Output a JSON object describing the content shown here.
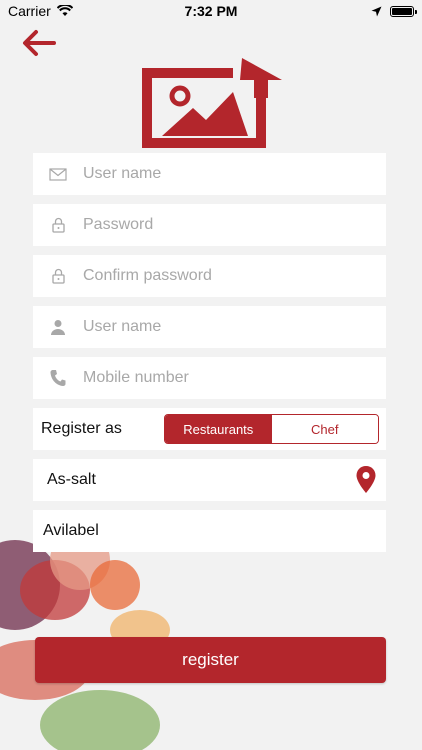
{
  "status_bar": {
    "carrier": "Carrier",
    "time": "7:32 PM"
  },
  "colors": {
    "accent": "#b3262c",
    "background": "#f2f2f2",
    "placeholder": "#a8a8a8"
  },
  "form": {
    "username_placeholder": "User name",
    "password_placeholder": "Password",
    "confirm_password_placeholder": "Confirm password",
    "name_placeholder": "User name",
    "mobile_placeholder": "Mobile number",
    "register_as_label": "Register as",
    "register_as_options": [
      "Restaurants",
      "Chef"
    ],
    "register_as_selected": "Restaurants",
    "location_value": "As-salt",
    "availability_value": "Avilabel",
    "submit_label": "register"
  },
  "icons": {
    "back": "arrow-left-icon",
    "logo": "image-upload-logo-icon",
    "email": "envelope-icon",
    "password": "lock-icon",
    "confirm_password": "lock-icon",
    "name": "person-icon",
    "mobile": "phone-icon",
    "location": "map-pin-icon"
  }
}
